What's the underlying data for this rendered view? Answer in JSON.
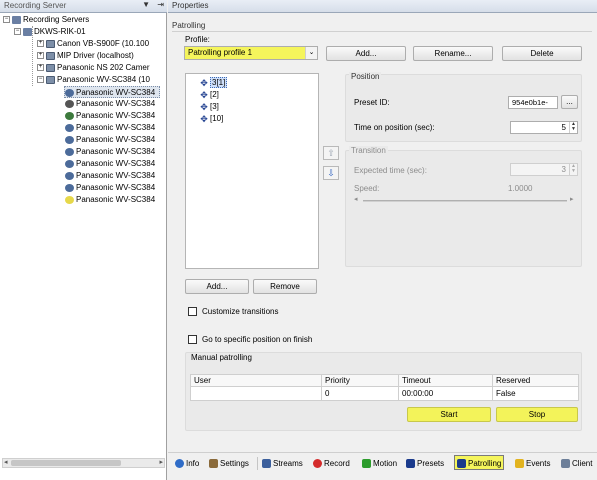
{
  "left_pane": {
    "title": "Recording Server",
    "header_buttons": [
      "▼",
      "⇥"
    ],
    "tree": [
      {
        "label": "Recording Servers",
        "icon": "recording-servers-icon"
      },
      {
        "label": "DKWS-RIK-01",
        "icon": "server-icon"
      },
      {
        "label": "Canon VB-S900F (10.100",
        "icon": "hardware-icon"
      },
      {
        "label": "MIP Driver (localhost)",
        "icon": "hardware-icon"
      },
      {
        "label": "Panasonic NS 202 Camer",
        "icon": "hardware-icon"
      },
      {
        "label": "Panasonic WV-SC384 (10",
        "icon": "hardware-icon"
      },
      {
        "label": "Panasonic WV-SC384",
        "icon": "camera-icon"
      },
      {
        "label": "Panasonic WV-SC384",
        "icon": "microphone-icon"
      },
      {
        "label": "Panasonic WV-SC384",
        "icon": "speaker-icon"
      },
      {
        "label": "Panasonic WV-SC384",
        "icon": "input-icon"
      },
      {
        "label": "Panasonic WV-SC384",
        "icon": "input-icon"
      },
      {
        "label": "Panasonic WV-SC384",
        "icon": "input-icon"
      },
      {
        "label": "Panasonic WV-SC384",
        "icon": "input-icon"
      },
      {
        "label": "Panasonic WV-SC384",
        "icon": "input-icon"
      },
      {
        "label": "Panasonic WV-SC384",
        "icon": "input-icon"
      },
      {
        "label": "Panasonic WV-SC384",
        "icon": "output-icon"
      }
    ]
  },
  "properties": {
    "title": "Properties",
    "patrolling_label": "Patrolling",
    "profile_label": "Profile:",
    "profile_value": "Patrolling profile 1",
    "buttons": {
      "add": "Add...",
      "rename": "Rename...",
      "delete": "Delete"
    },
    "presets": [
      "3[1]",
      "[2]",
      "[3]",
      "[10]"
    ],
    "preset_buttons": {
      "add": "Add...",
      "remove": "Remove"
    },
    "position": {
      "group_title": "Position",
      "preset_id_label": "Preset ID:",
      "preset_id_value": "954e0b1e-",
      "browse_label": "...",
      "time_label": "Time on position (sec):",
      "time_value": "5"
    },
    "transition": {
      "group_title": "Transition",
      "expected_label": "Expected time (sec):",
      "expected_value": "3",
      "speed_label": "Speed:",
      "speed_value": "1.0000"
    },
    "checkboxes": {
      "customize": "Customize transitions",
      "goto_end": "Go to specific position on finish"
    },
    "manual": {
      "title": "Manual patrolling",
      "columns": [
        "User",
        "Priority",
        "Timeout",
        "Reserved"
      ],
      "rows": [
        [
          "",
          "0",
          "00:00:00",
          "False"
        ]
      ],
      "start_label": "Start",
      "stop_label": "Stop"
    }
  },
  "tabs": [
    {
      "label": "Info",
      "icon": "info-icon"
    },
    {
      "label": "Settings",
      "icon": "settings-icon"
    },
    {
      "label": "Streams",
      "icon": "streams-icon"
    },
    {
      "label": "Record",
      "icon": "record-icon"
    },
    {
      "label": "Motion",
      "icon": "motion-icon"
    },
    {
      "label": "Presets",
      "icon": "presets-icon"
    },
    {
      "label": "Patrolling",
      "icon": "patrolling-icon",
      "active": true
    },
    {
      "label": "Events",
      "icon": "events-icon"
    },
    {
      "label": "Client",
      "icon": "client-icon"
    }
  ],
  "colors": {
    "highlight": "#f5f55c",
    "selection": "#cfe0fb"
  }
}
